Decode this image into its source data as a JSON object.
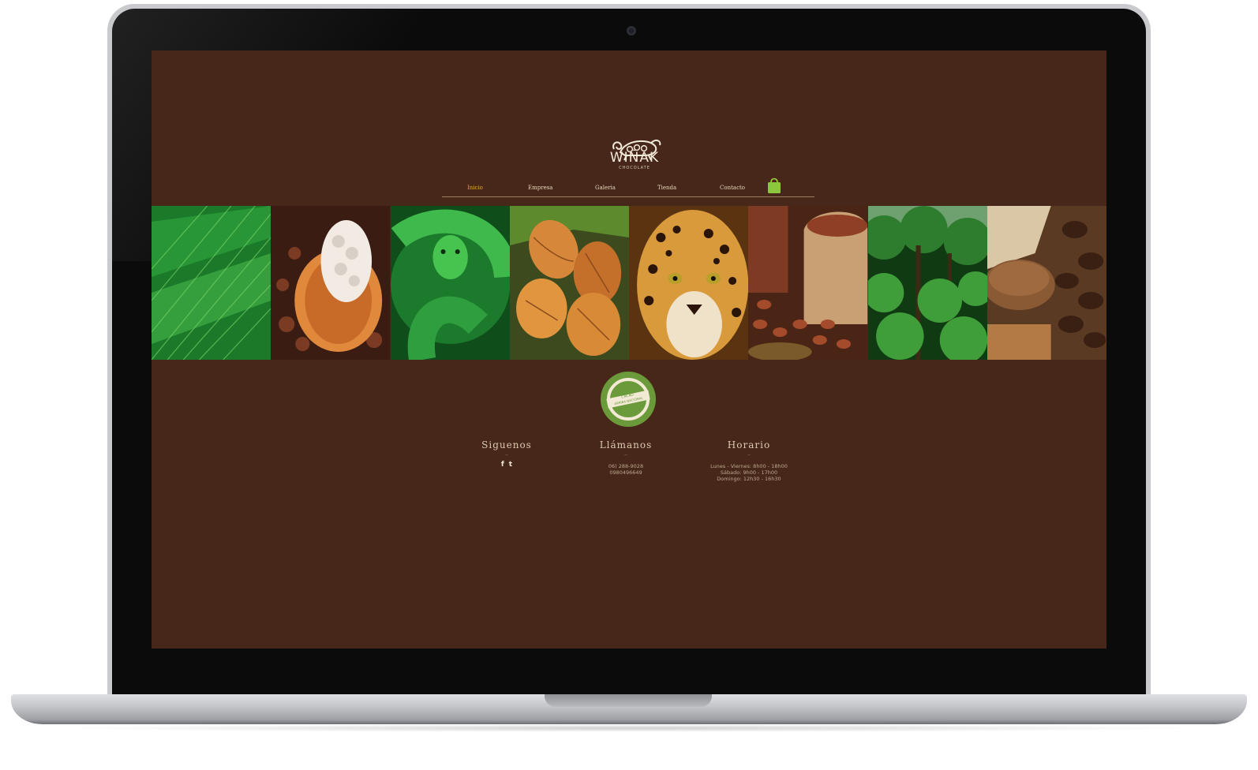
{
  "brand": {
    "name": "WIÑAK",
    "tagline": "CHOCOLATE"
  },
  "nav": {
    "items": [
      {
        "label": "Inicio",
        "active": true
      },
      {
        "label": "Empresa"
      },
      {
        "label": "Galeria"
      },
      {
        "label": "Tienda"
      },
      {
        "label": "Contacto"
      }
    ],
    "accent_color": "#e3a93b",
    "cart_icon": "shopping-bag-icon"
  },
  "gallery": {
    "tiles": [
      {
        "name": "palm-leaf"
      },
      {
        "name": "cacao-pod-open"
      },
      {
        "name": "green-snake"
      },
      {
        "name": "cacao-pods"
      },
      {
        "name": "jaguar"
      },
      {
        "name": "cacao-beans-sack"
      },
      {
        "name": "rainforest"
      },
      {
        "name": "cocoa-powder-beans"
      }
    ]
  },
  "badge": {
    "line1": "CACAO",
    "line2": "ARRIBA NACIONAL"
  },
  "footer": {
    "follow": {
      "title": "Siguenos",
      "dash": "–",
      "icons": [
        "facebook-icon",
        "twitter-icon"
      ],
      "facebook": "f",
      "twitter": "t"
    },
    "call": {
      "title": "Llámanos",
      "dash": "–",
      "phone1": "06) 288-9028",
      "phone2": "0980496649"
    },
    "hours": {
      "title": "Horario",
      "dash": "–",
      "line1": "Lunes - Viernes: 8h00 - 18h00",
      "line2": "Sábado: 9h00 - 17h00",
      "line3": "Domingo: 12h30 - 16h30"
    }
  },
  "colors": {
    "page_bg": "#47271a",
    "text": "#dccbb0",
    "badge_green": "#6a9a3a"
  }
}
